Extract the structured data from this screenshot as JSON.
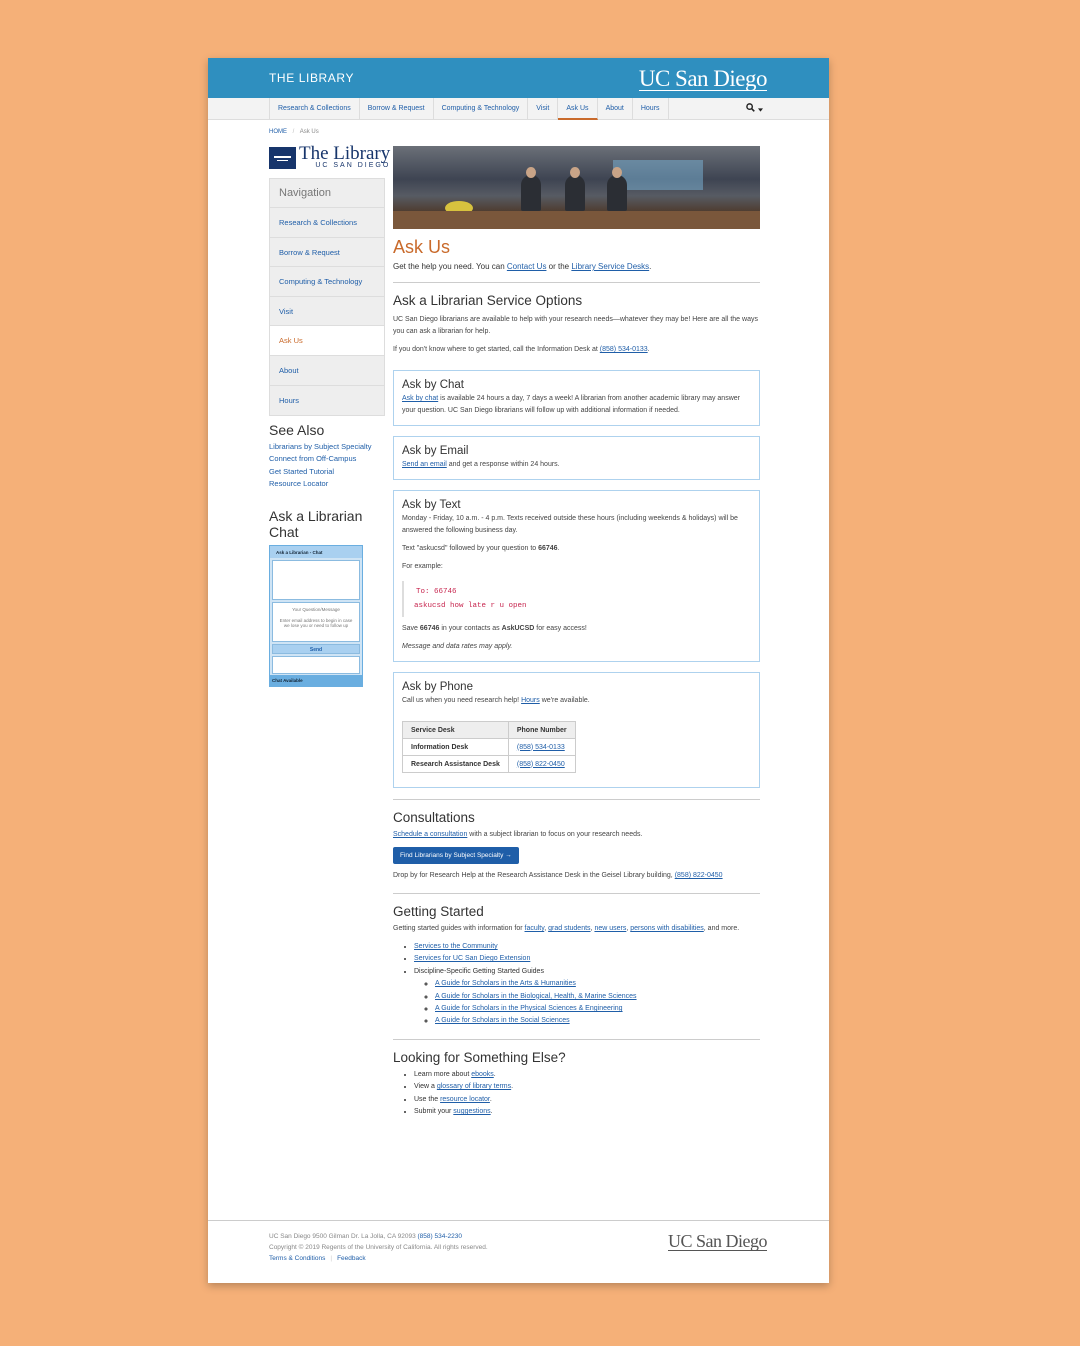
{
  "header": {
    "library_label": "THE LIBRARY",
    "ucsd_logo": "UC San Diego"
  },
  "nav": {
    "items": [
      "Research & Collections",
      "Borrow & Request",
      "Computing & Technology",
      "Visit",
      "Ask Us",
      "About",
      "Hours"
    ],
    "active": "Ask Us",
    "search_icon": "search-icon"
  },
  "breadcrumb": {
    "home": "HOME",
    "sep": "/",
    "current": "Ask Us"
  },
  "brand": {
    "title": "The Library",
    "subtitle": "UC SAN DIEGO"
  },
  "sidebar": {
    "heading": "Navigation",
    "items": [
      "Research & Collections",
      "Borrow & Request",
      "Computing & Technology",
      "Visit",
      "Ask Us",
      "About",
      "Hours"
    ]
  },
  "see_also": {
    "heading": "See Also",
    "links": [
      "Librarians by Subject Specialty",
      "Connect from Off-Campus",
      "Get Started Tutorial",
      "Resource Locator"
    ]
  },
  "chat_widget": {
    "heading": "Ask a Librarian Chat",
    "title": "Ask a Librarian - Chat",
    "question_label": "Your Question/Message",
    "email_hint": "Enter email address to begin in case we lose you or need to follow up",
    "send": "Send",
    "status": "Chat Available"
  },
  "main": {
    "title": "Ask Us",
    "lead_pre": "Get the help you need. You can ",
    "lead_link1": "Contact Us",
    "lead_mid": " or the ",
    "lead_link2": "Library Service Desks",
    "lead_post": ".",
    "options": {
      "heading": "Ask a Librarian Service Options",
      "p1": "UC San Diego librarians are available to help with your research needs—whatever they may be! Here are all the ways you can ask a librarian for help.",
      "p2_pre": "If you don't know where to get started, call the Information Desk at ",
      "p2_phone": "(858) 534-0133",
      "p2_post": "."
    },
    "chat": {
      "heading": "Ask by Chat",
      "link": "Ask by chat",
      "text": " is available 24 hours a day, 7 days a week! A librarian from another academic library may answer your question. UC San Diego librarians will follow up with additional information if needed."
    },
    "email": {
      "heading": "Ask by Email",
      "link": "Send an email",
      "text": " and get a response within 24 hours."
    },
    "text": {
      "heading": "Ask by Text",
      "hours": "Monday - Friday, 10 a.m. - 4 p.m.  Texts received outside these hours (including weekends & holidays) will be answered the following business day.",
      "instr_pre": "Text \"askucsd\" followed by your question to ",
      "instr_num": "66746",
      "instr_post": ".",
      "example_label": "For example:",
      "code1": "To: 66746",
      "code2": "askucsd how late r u open",
      "save_pre": "Save ",
      "save_num": "66746",
      "save_mid": " in your contacts as ",
      "save_name": "AskUCSD",
      "save_post": " for easy access!",
      "rates": "Message and data rates may apply."
    },
    "phone": {
      "heading": "Ask by Phone",
      "text_pre": "Call us when you need research help! ",
      "text_link": "Hours",
      "text_post": " we're available.",
      "table": {
        "headers": [
          "Service Desk",
          "Phone Number"
        ],
        "rows": [
          [
            "Information Desk",
            "(858) 534-0133"
          ],
          [
            "Research Assistance Desk",
            "(858) 822-0450"
          ]
        ]
      }
    },
    "consultations": {
      "heading": "Consultations",
      "link": "Schedule a consultation",
      "text": " with a subject librarian to focus on your research needs.",
      "button": "Find Librarians by Subject Specialty →",
      "drop_pre": "Drop by for Research Help at the Research Assistance Desk in the Geisel Library building, ",
      "drop_phone": "(858) 822-0450"
    },
    "getting_started": {
      "heading": "Getting Started",
      "intro_pre": "Getting started guides with information for ",
      "links": [
        "faculty",
        "grad students",
        "new users",
        "persons with disabilities"
      ],
      "intro_post": ", and more.",
      "list": [
        "Services to the Community",
        "Services for UC San Diego Extension",
        "Discipline-Specific Getting Started Guides"
      ],
      "sublist": [
        "A Guide for Scholars in the Arts & Humanities",
        "A Guide for Scholars in the Biological, Health, & Marine Sciences",
        "A Guide for Scholars in the Physical Sciences & Engineering",
        "A Guide for Scholars in the Social Sciences"
      ]
    },
    "else": {
      "heading": "Looking for Something Else?",
      "items": [
        {
          "pre": "Learn more about ",
          "link": "ebooks",
          "post": "."
        },
        {
          "pre": "View a ",
          "link": "glossary of library terms",
          "post": "."
        },
        {
          "pre": "Use the ",
          "link": "resource locator",
          "post": "."
        },
        {
          "pre": "Submit your ",
          "link": "suggestions",
          "post": "."
        }
      ]
    }
  },
  "footer": {
    "address": "UC San Diego 9500 Gilman Dr. La Jolla, CA 92093",
    "phone": "(858) 534-2230",
    "copyright": "Copyright © 2019 Regents of the University of California. All rights reserved.",
    "terms": "Terms & Conditions",
    "feedback": "Feedback",
    "logo": "UC San Diego"
  }
}
